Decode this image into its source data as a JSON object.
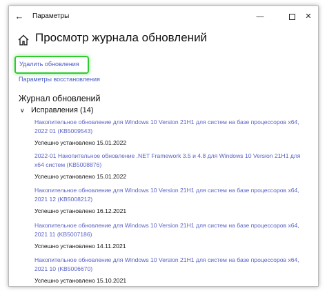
{
  "window": {
    "title": "Параметры",
    "minimize_glyph": "—",
    "close_glyph": "✕",
    "back_glyph": "←"
  },
  "header": {
    "page_title": "Просмотр журнала обновлений"
  },
  "links": {
    "uninstall_updates": "Удалить обновления",
    "recovery_options": "Параметры восстановления"
  },
  "history": {
    "section_title": "Журнал обновлений",
    "group_label": "Исправления (14)",
    "chevron_glyph": "∨",
    "items": [
      {
        "title": "Накопительное обновление для Windows 10 Version 21H1 для систем на базе процессоров x64, 2022 01 (KB5009543)",
        "status": "Успешно установлено 15.01.2022"
      },
      {
        "title": "2022-01 Накопительное обновление .NET Framework 3.5 и 4.8 для Windows 10 Version 21H1 для x64 систем (KB5008876)",
        "status": "Успешно установлено 15.01.2022"
      },
      {
        "title": "Накопительное обновление для Windows 10 Version 21H1 для систем на базе процессоров x64, 2021 12 (KB5008212)",
        "status": "Успешно установлено 16.12.2021"
      },
      {
        "title": "Накопительное обновление для Windows 10 Version 21H1 для систем на базе процессоров x64, 2021 11 (KB5007186)",
        "status": "Успешно установлено 14.11.2021"
      },
      {
        "title": "Накопительное обновление для Windows 10 Version 21H1 для систем на базе процессоров x64, 2021 10 (KB5006670)",
        "status": "Успешно установлено 15.10.2021"
      }
    ]
  },
  "colors": {
    "link": "#5a63c4",
    "highlight_border": "#2ecb2e"
  }
}
